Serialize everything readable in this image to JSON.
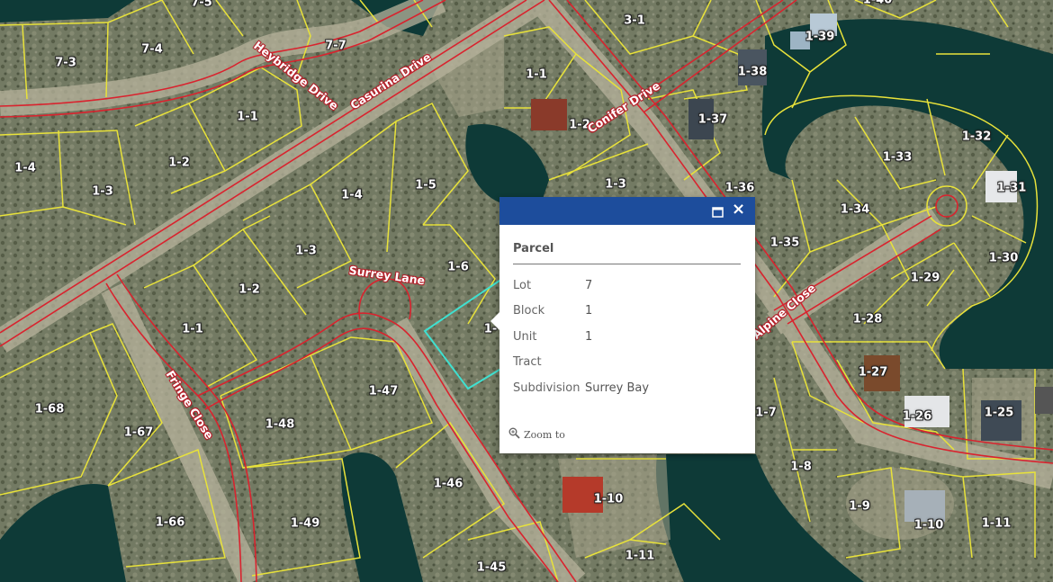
{
  "map": {
    "parcel_labels": [
      "7-5",
      "7-3",
      "7-4",
      "7-7",
      "3-1",
      "1-40",
      "1-39",
      "1-38",
      "1-1",
      "1-37",
      "1-2",
      "1-4",
      "1-3",
      "1-1",
      "1-2",
      "1-4",
      "1-5",
      "1-3",
      "1-36",
      "1-32",
      "1-33",
      "1-31",
      "1-34",
      "1-35",
      "1-30",
      "1-3",
      "1-6",
      "1-2",
      "1-29",
      "1-28",
      "1-1",
      "1-27",
      "1-47",
      "1-68",
      "1-48",
      "1-67",
      "1-26",
      "1-25",
      "1-7",
      "1-8",
      "1-46",
      "1-66",
      "1-49",
      "1-10",
      "1-9",
      "1-10",
      "1-11",
      "1-45",
      "1-11",
      "1-"
    ],
    "road_names": [
      "Heybridge Drive",
      "Casurina Drive",
      "Conifer Drive",
      "Surrey Lane",
      "Fringe Close",
      "Alpine Close"
    ]
  },
  "popup": {
    "title": "Parcel",
    "maximize_icon": "maximize-icon",
    "close_icon": "close-icon",
    "close_glyph": "×",
    "fields": [
      {
        "key": "Lot",
        "value": "7"
      },
      {
        "key": "Block",
        "value": "1"
      },
      {
        "key": "Unit",
        "value": "1"
      },
      {
        "key": "Tract",
        "value": ""
      },
      {
        "key": "Subdivision",
        "value": "Surrey Bay"
      }
    ],
    "zoom_label": "Zoom to",
    "zoom_icon": "magnifier-icon"
  },
  "colors": {
    "header_blue": "#1d4d9c",
    "parcel_line": "#e8e23a",
    "road_line": "#d9232e",
    "selected_parcel": "#3fe0d0",
    "water": "#0d3a36"
  }
}
